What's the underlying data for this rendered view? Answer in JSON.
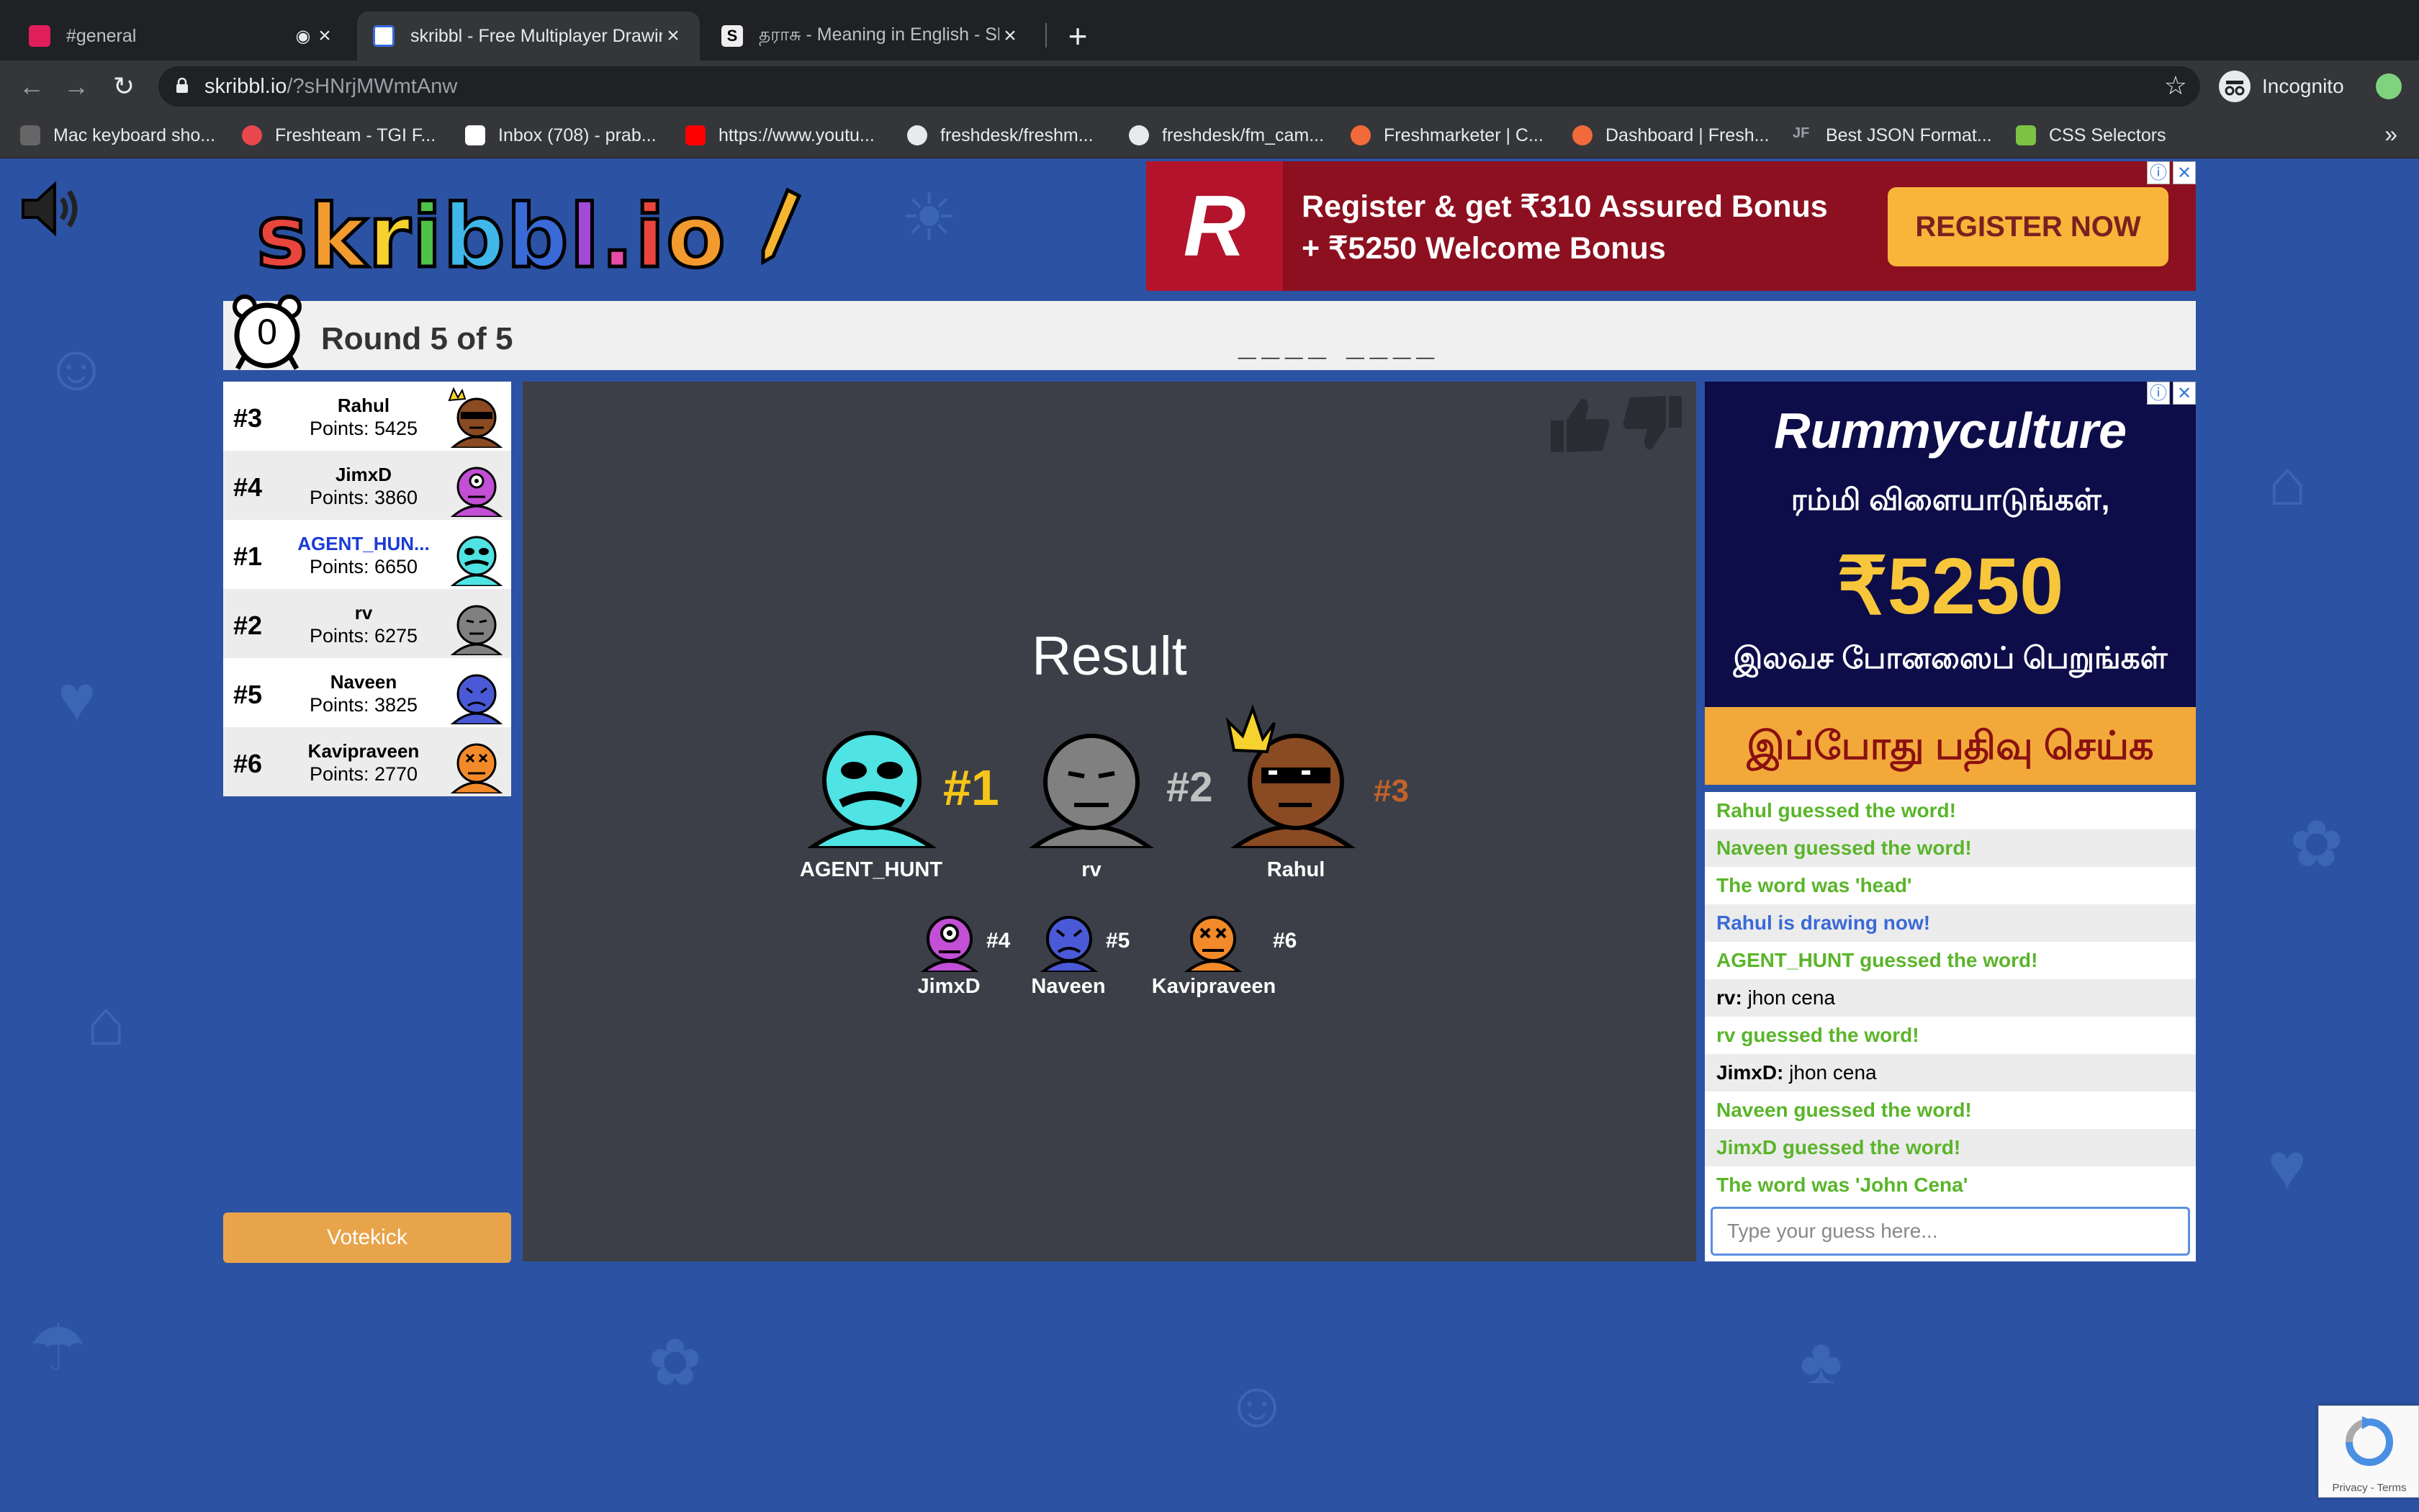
{
  "browser": {
    "tabs": [
      {
        "title": "#general",
        "active": false,
        "icon": "slack-icon"
      },
      {
        "title": "skribbl - Free Multiplayer Drawing",
        "active": true,
        "icon": "skribbl-icon"
      },
      {
        "title": "தராசு - Meaning in English - Sh",
        "active": false,
        "icon": "shabdkosh-icon"
      }
    ],
    "url_host": "skribbl.io",
    "url_path": "/?sHNrjMWmtAnw",
    "profile_label": "Incognito",
    "bookmarks": [
      "Mac keyboard sho...",
      "Freshteam - TGI F...",
      "Inbox (708) - prab...",
      "https://www.youtu...",
      "freshdesk/freshm...",
      "freshdesk/fm_cam...",
      "Freshmarketer | C...",
      "Dashboard | Fresh...",
      "Best JSON Format...",
      "CSS Selectors"
    ],
    "bookmarks_more": "»"
  },
  "ad_top": {
    "logo": "R",
    "line1": "Register & get ₹310 Assured Bonus",
    "line2": "+ ₹5250 Welcome Bonus",
    "button": "REGISTER NOW"
  },
  "game": {
    "timer": "0",
    "round": "Round 5 of 5",
    "word_hint": "____ ____",
    "votekick": "Votekick",
    "result_title": "Result",
    "players": [
      {
        "rank": "#3",
        "name": "Rahul",
        "points": "Points: 5425",
        "me": false,
        "color": "#8a4a22"
      },
      {
        "rank": "#4",
        "name": "JimxD",
        "points": "Points: 3860",
        "me": false,
        "color": "#c24fd6"
      },
      {
        "rank": "#1",
        "name": "AGENT_HUN...",
        "points": "Points: 6650",
        "me": true,
        "color": "#4fe3e3"
      },
      {
        "rank": "#2",
        "name": "rv",
        "points": "Points: 6275",
        "me": false,
        "color": "#808080"
      },
      {
        "rank": "#5",
        "name": "Naveen",
        "points": "Points: 3825",
        "me": false,
        "color": "#4a5ad6"
      },
      {
        "rank": "#6",
        "name": "Kavipraveen",
        "points": "Points: 2770",
        "me": false,
        "color": "#f28a2a"
      }
    ],
    "podium": [
      {
        "rank": "#1",
        "name": "AGENT_HUNT"
      },
      {
        "rank": "#2",
        "name": "rv"
      },
      {
        "rank": "#3",
        "name": "Rahul"
      }
    ],
    "others": [
      {
        "rank": "#4",
        "name": "JimxD"
      },
      {
        "rank": "#5",
        "name": "Naveen"
      },
      {
        "rank": "#6",
        "name": "Kavipraveen"
      }
    ]
  },
  "ad_side": {
    "brand": "Rummyculture",
    "line1": "ரம்மி விளையாடுங்கள்,",
    "amount": "₹5250",
    "line2": "இலவச போனஸைப் பெறுங்கள்",
    "cta": "இப்போது பதிவு செய்க"
  },
  "chat": {
    "messages": [
      {
        "type": "green",
        "text": "Rahul guessed the word!"
      },
      {
        "type": "green",
        "text": "Naveen guessed the word!"
      },
      {
        "type": "green",
        "text": "The word was 'head'"
      },
      {
        "type": "blue",
        "text": "Rahul is drawing now!"
      },
      {
        "type": "green",
        "text": "AGENT_HUNT guessed the word!"
      },
      {
        "type": "plain",
        "author": "rv:",
        "text": "jhon cena"
      },
      {
        "type": "green",
        "text": "rv guessed the word!"
      },
      {
        "type": "plain",
        "author": "JimxD:",
        "text": "jhon cena"
      },
      {
        "type": "green",
        "text": "Naveen guessed the word!"
      },
      {
        "type": "green",
        "text": "JimxD guessed the word!"
      },
      {
        "type": "green",
        "text": "The word was 'John Cena'"
      }
    ],
    "input_placeholder": "Type your guess here..."
  },
  "recaptcha": {
    "terms": "Privacy - Terms"
  },
  "colors": {
    "background": "#2c52a3",
    "canvas": "#3c3f47",
    "gold": "#f5c518",
    "silver": "#c0c0c0",
    "bronze": "#c0622a",
    "chat_green": "#5ab52a",
    "chat_blue": "#3a6ad8",
    "votekick": "#e8a44a"
  }
}
